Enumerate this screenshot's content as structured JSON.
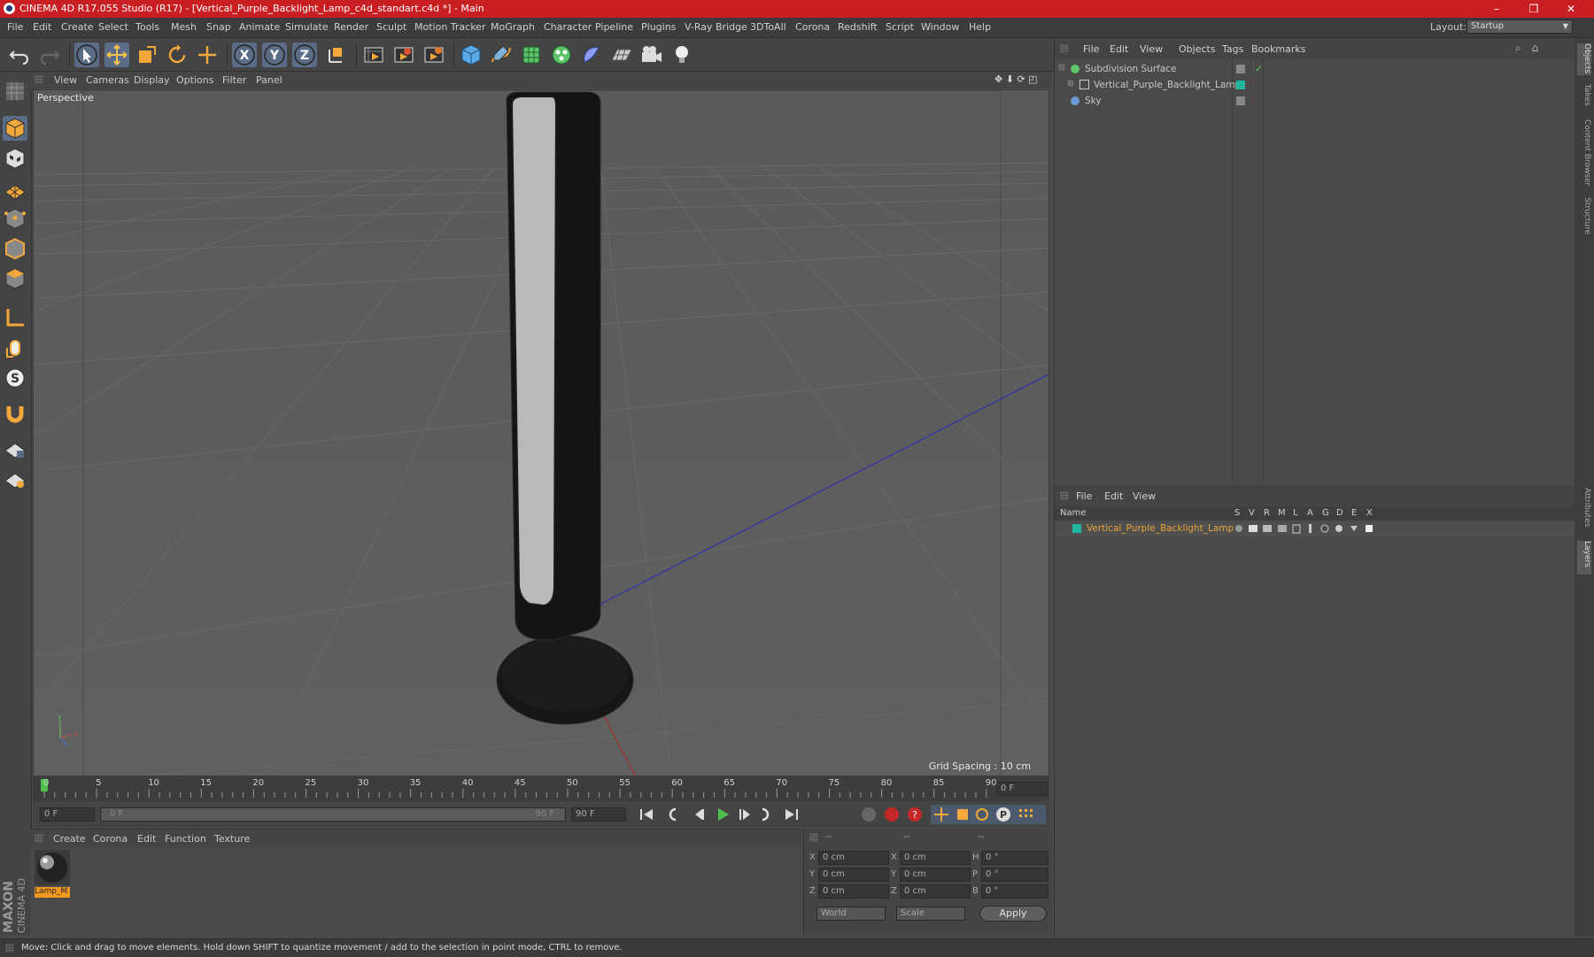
{
  "window": {
    "title": "CINEMA 4D R17.055 Studio (R17) - [Vertical_Purple_Backlight_Lamp_c4d_standart.c4d *] - Main",
    "minimize": "–",
    "maximize": "❐",
    "close": "✕"
  },
  "menu": [
    "File",
    "Edit",
    "Create",
    "Select",
    "Tools",
    "Mesh",
    "Snap",
    "Animate",
    "Simulate",
    "Render",
    "Sculpt",
    "Motion Tracker",
    "MoGraph",
    "Character",
    "Pipeline",
    "Plugins",
    "V-Ray Bridge",
    "3DToAll",
    "Corona",
    "Redshift",
    "Script",
    "Window",
    "Help"
  ],
  "layout": {
    "label": "Layout:",
    "value": "Startup"
  },
  "viewport": {
    "menu": [
      "View",
      "Cameras",
      "Display",
      "Options",
      "Filter",
      "Panel"
    ],
    "camera_label": "Perspective",
    "grid_spacing": "Grid Spacing : 10 cm"
  },
  "timeline": {
    "ticks": [
      "0",
      "5",
      "10",
      "15",
      "20",
      "25",
      "30",
      "35",
      "40",
      "45",
      "50",
      "55",
      "60",
      "65",
      "70",
      "75",
      "80",
      "85",
      "90"
    ],
    "current_frame": "0 F",
    "start_field": "0 F",
    "range_start": "0 F",
    "range_end": "90 F",
    "end_field": "90 F"
  },
  "material_manager": {
    "menu": [
      "Create",
      "Corona",
      "Edit",
      "Function",
      "Texture"
    ],
    "materials": [
      {
        "label": "Lamp_M"
      }
    ]
  },
  "coordinates": {
    "headers": [
      "--",
      "--",
      "--"
    ],
    "rows": [
      {
        "a": "X",
        "av": "0 cm",
        "b": "X",
        "bv": "0 cm",
        "c": "H",
        "cv": "0 °"
      },
      {
        "a": "Y",
        "av": "0 cm",
        "b": "Y",
        "bv": "0 cm",
        "c": "P",
        "cv": "0 °"
      },
      {
        "a": "Z",
        "av": "0 cm",
        "b": "Z",
        "bv": "0 cm",
        "c": "B",
        "cv": "0 °"
      }
    ],
    "mode1": "World",
    "mode2": "Scale",
    "apply": "Apply"
  },
  "brand": {
    "line1": "MAXON",
    "line2": "CINEMA 4D"
  },
  "status": "Move: Click and drag to move elements. Hold down SHIFT to quantize movement / add to the selection in point mode, CTRL to remove.",
  "object_manager": {
    "menu": [
      "File",
      "Edit",
      "View",
      "Objects",
      "Tags",
      "Bookmarks"
    ],
    "objects": [
      {
        "name": "Subdivision Surface",
        "color": "#d8d8d8"
      },
      {
        "name": "Vertical_Purple_Backlight_Lamp",
        "color": "#d8d8d8"
      },
      {
        "name": "Sky",
        "color": "#d8d8d8"
      }
    ]
  },
  "layer_manager": {
    "menu": [
      "File",
      "Edit",
      "View"
    ],
    "columns": [
      "Name",
      "S",
      "V",
      "R",
      "M",
      "L",
      "A",
      "G",
      "D",
      "E",
      "X"
    ],
    "layers": [
      {
        "name": "Vertical_Purple_Backlight_Lamp",
        "color": "#e8a33a",
        "swatch": "#1fb5a0"
      }
    ]
  },
  "right_tabs": [
    "Objects",
    "Takes",
    "Content Browser",
    "Structure",
    "Attributes",
    "Layers"
  ]
}
